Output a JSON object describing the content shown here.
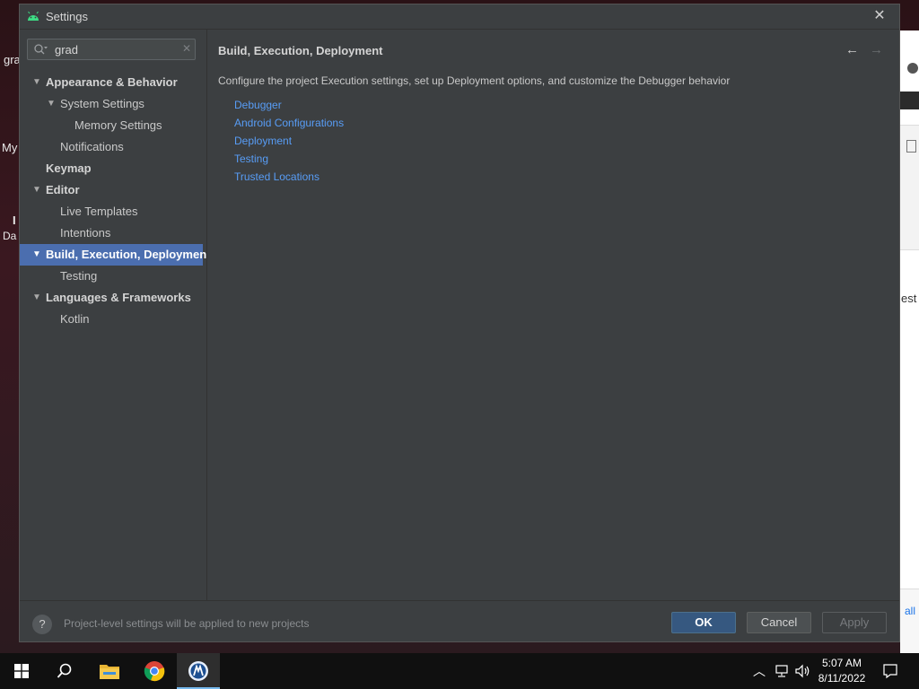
{
  "desktop": {
    "snippets": [
      "gra",
      "My",
      "Da",
      "I"
    ],
    "right_app": {
      "text_est": "est",
      "text_all": "all"
    }
  },
  "dialog": {
    "title": "Settings",
    "close_glyph": "✕"
  },
  "search": {
    "value": "grad",
    "placeholder": ""
  },
  "tree": [
    {
      "label": "Appearance & Behavior",
      "bold": true,
      "expanded": true,
      "level": 0
    },
    {
      "label": "System Settings",
      "bold": false,
      "expanded": true,
      "level": 1
    },
    {
      "label": "Memory Settings",
      "bold": false,
      "level": 2
    },
    {
      "label": "Notifications",
      "bold": false,
      "level": 1
    },
    {
      "label": "Keymap",
      "bold": true,
      "level": 0
    },
    {
      "label": "Editor",
      "bold": true,
      "expanded": true,
      "level": 0
    },
    {
      "label": "Live Templates",
      "bold": false,
      "level": 1
    },
    {
      "label": "Intentions",
      "bold": false,
      "level": 1
    },
    {
      "label": "Build, Execution, Deployment",
      "bold": true,
      "expanded": true,
      "level": 0,
      "selected": true
    },
    {
      "label": "Testing",
      "bold": false,
      "level": 1
    },
    {
      "label": "Languages & Frameworks",
      "bold": true,
      "expanded": true,
      "level": 0
    },
    {
      "label": "Kotlin",
      "bold": false,
      "level": 1
    }
  ],
  "content": {
    "breadcrumb": "Build, Execution, Deployment",
    "description": "Configure the project Execution settings, set up Deployment options, and customize the Debugger behavior",
    "links": [
      "Debugger",
      "Android Configurations",
      "Deployment",
      "Testing",
      "Trusted Locations"
    ]
  },
  "footer": {
    "help": "?",
    "message": "Project-level settings will be applied to new projects",
    "ok": "OK",
    "cancel": "Cancel",
    "apply": "Apply"
  },
  "taskbar": {
    "time": "5:07 AM",
    "date": "8/11/2022"
  },
  "colors": {
    "accent_selection": "#4b6eaf",
    "link": "#589df6",
    "ok_button": "#365880",
    "panel": "#3c3f41"
  }
}
